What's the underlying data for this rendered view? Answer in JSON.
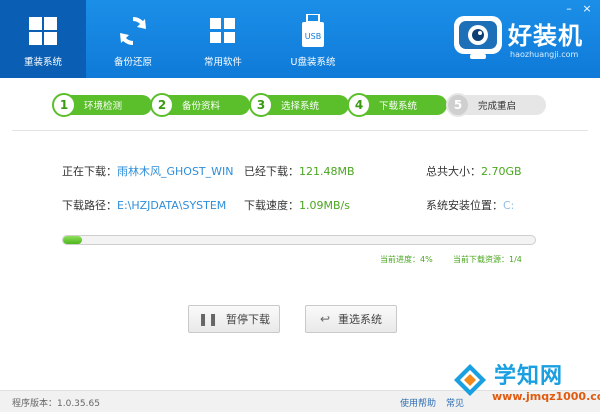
{
  "nav": {
    "items": [
      {
        "label": "重装系统",
        "icon": "windows-icon",
        "active": true
      },
      {
        "label": "备份还原",
        "icon": "refresh-icon",
        "active": false
      },
      {
        "label": "常用软件",
        "icon": "grid-icon",
        "active": false
      },
      {
        "label": "U盘装系统",
        "icon": "usb-icon",
        "active": false
      }
    ]
  },
  "brand": {
    "name": "好装机",
    "url": "haozhuangji.com"
  },
  "steps": [
    {
      "num": "1",
      "label": "环境检测",
      "status": "done"
    },
    {
      "num": "2",
      "label": "备份资料",
      "status": "done"
    },
    {
      "num": "3",
      "label": "选择系统",
      "status": "done"
    },
    {
      "num": "4",
      "label": "下载系统",
      "status": "done"
    },
    {
      "num": "5",
      "label": "完成重启",
      "status": "pending"
    }
  ],
  "download": {
    "downloading_label": "正在下载：",
    "downloading_value": "雨林木风_GHOST_WIN",
    "downloaded_label": "已经下载：",
    "downloaded_value": "121.48MB",
    "total_label": "总共大小：",
    "total_value": "2.70GB",
    "path_label": "下载路径：",
    "path_value": "E:\\HZJDATA\\SYSTEM",
    "speed_label": "下载速度：",
    "speed_value": "1.09MB/s",
    "install_label": "系统安装位置：",
    "install_value": "C:"
  },
  "progress": {
    "percent": 4,
    "current_progress_label": "当前进度：",
    "current_progress_value": "4%",
    "current_resource_label": "当前下载资源：",
    "current_resource_value": "1/4"
  },
  "buttons": {
    "pause": "暂停下载",
    "reselect": "重选系统"
  },
  "footer": {
    "version": "程序版本：1.0.35.65",
    "help": "使用帮助",
    "faq": "常见"
  },
  "watermark": {
    "name": "学知网",
    "url": "www.jmqz1000.com"
  },
  "colors": {
    "header_blue": "#0f7ad8",
    "nav_active": "#0a5fb4",
    "step_green": "#5bbf2b",
    "value_green": "#4aa61f",
    "value_blue": "#2f8ed8"
  }
}
